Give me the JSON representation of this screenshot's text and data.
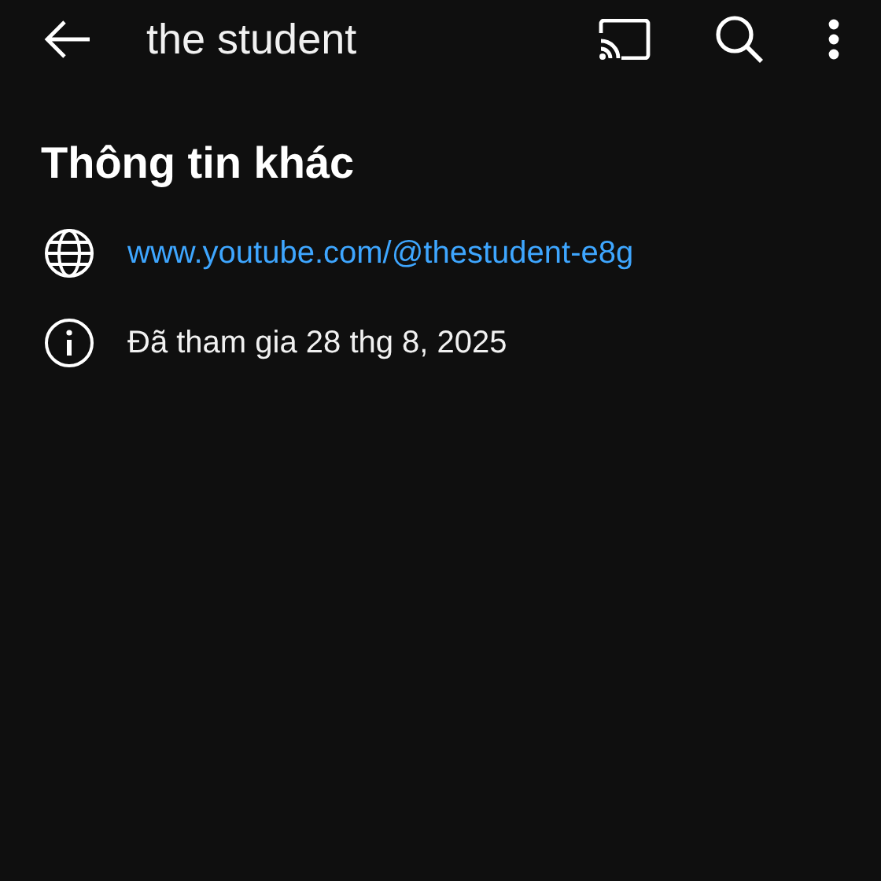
{
  "top_bar": {
    "title": "the student"
  },
  "section": {
    "heading": "Thông tin khác",
    "rows": [
      {
        "kind": "link",
        "text": "www.youtube.com/@thestudent-e8g"
      },
      {
        "kind": "joined",
        "text": "Đã tham gia 28 thg 8, 2025"
      }
    ]
  }
}
